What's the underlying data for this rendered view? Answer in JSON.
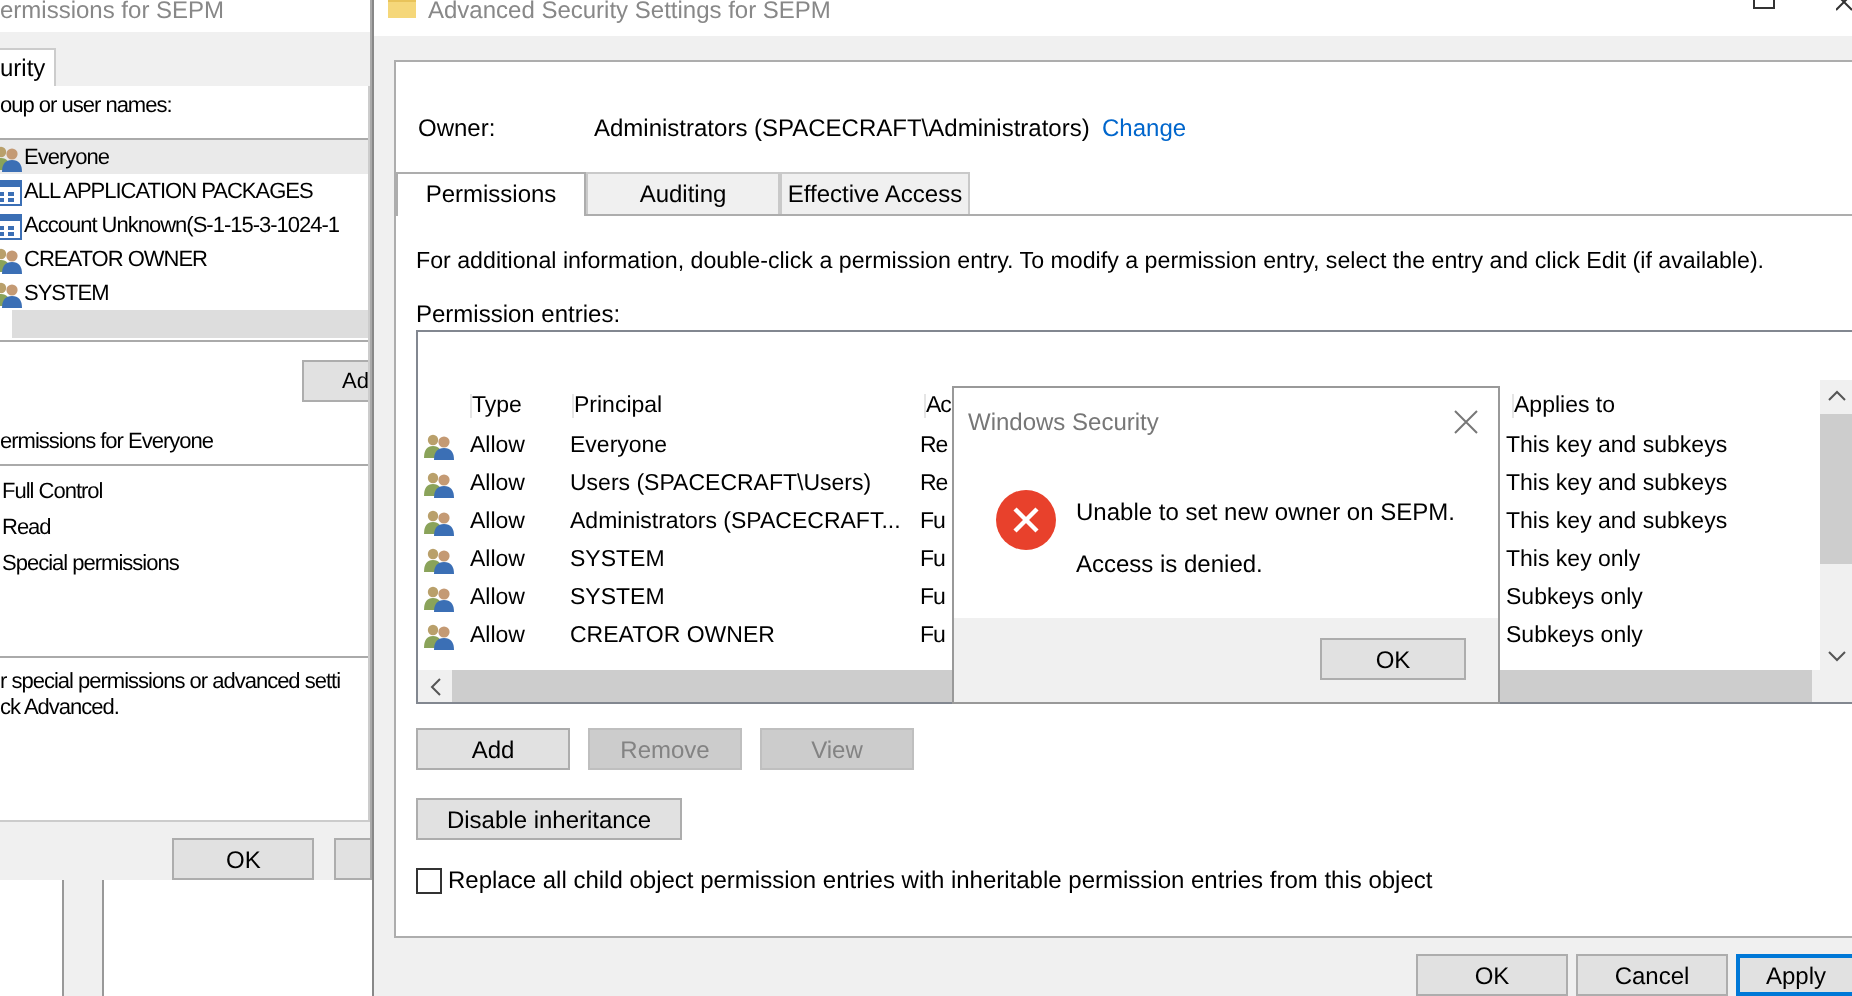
{
  "back_window": {
    "title": "ermissions for SEPM",
    "tab": "urity",
    "names_label": "oup or user names:",
    "names": [
      {
        "name": "Everyone",
        "kind": "group",
        "selected": true
      },
      {
        "name": "ALL APPLICATION PACKAGES",
        "kind": "package",
        "selected": false
      },
      {
        "name": "Account Unknown(S-1-15-3-1024-1",
        "kind": "package",
        "selected": false
      },
      {
        "name": "CREATOR OWNER",
        "kind": "group",
        "selected": false
      },
      {
        "name": "SYSTEM",
        "kind": "group",
        "selected": false
      }
    ],
    "add_button": "Ad",
    "perms_label": "ermissions for Everyone",
    "perms": [
      "Full Control",
      "Read",
      "Special permissions"
    ],
    "advanced_note": [
      "r special permissions or advanced setti",
      "ck Advanced."
    ],
    "ok_button": "OK"
  },
  "advanced_window": {
    "title": "Advanced Security Settings for SEPM",
    "owner_label": "Owner:",
    "owner": "Administrators (SPACECRAFT\\Administrators)",
    "change_link": "Change",
    "tabs": [
      {
        "label": "Permissions",
        "selected": true
      },
      {
        "label": "Auditing",
        "selected": false
      },
      {
        "label": "Effective Access",
        "selected": false
      }
    ],
    "description": "For additional information, double-click a permission entry. To modify a permission entry, select the entry and click Edit (if available).",
    "entries_label": "Permission entries:",
    "table": {
      "columns": [
        "Type",
        "Principal",
        "Ac",
        "Applies to"
      ],
      "rows": [
        {
          "type": "Allow",
          "principal": "Everyone",
          "access": "Re",
          "applies_to": "This key and subkeys"
        },
        {
          "type": "Allow",
          "principal": "Users (SPACECRAFT\\Users)",
          "access": "Re",
          "applies_to": "This key and subkeys"
        },
        {
          "type": "Allow",
          "principal": "Administrators (SPACECRAFT...",
          "access": "Fu",
          "applies_to": "This key and subkeys"
        },
        {
          "type": "Allow",
          "principal": "SYSTEM",
          "access": "Fu",
          "applies_to": "This key only"
        },
        {
          "type": "Allow",
          "principal": "SYSTEM",
          "access": "Fu",
          "applies_to": "Subkeys only"
        },
        {
          "type": "Allow",
          "principal": "CREATOR OWNER",
          "access": "Fu",
          "applies_to": "Subkeys only"
        }
      ]
    },
    "buttons": [
      {
        "label": "Add",
        "disabled": false
      },
      {
        "label": "Remove",
        "disabled": true
      },
      {
        "label": "View",
        "disabled": true
      }
    ],
    "inheritance_button": "Disable inheritance",
    "replace_checkbox": {
      "label": "Replace all child object permission entries with inheritable permission entries from this object",
      "checked": false
    },
    "footer_buttons": [
      {
        "label": "OK",
        "default": false
      },
      {
        "label": "Cancel",
        "default": false
      },
      {
        "label": "Apply",
        "default": true
      }
    ]
  },
  "dialog": {
    "title": "Windows Security",
    "message": "Unable to set new owner on SEPM.",
    "detail": "Access is denied.",
    "button": "OK"
  }
}
